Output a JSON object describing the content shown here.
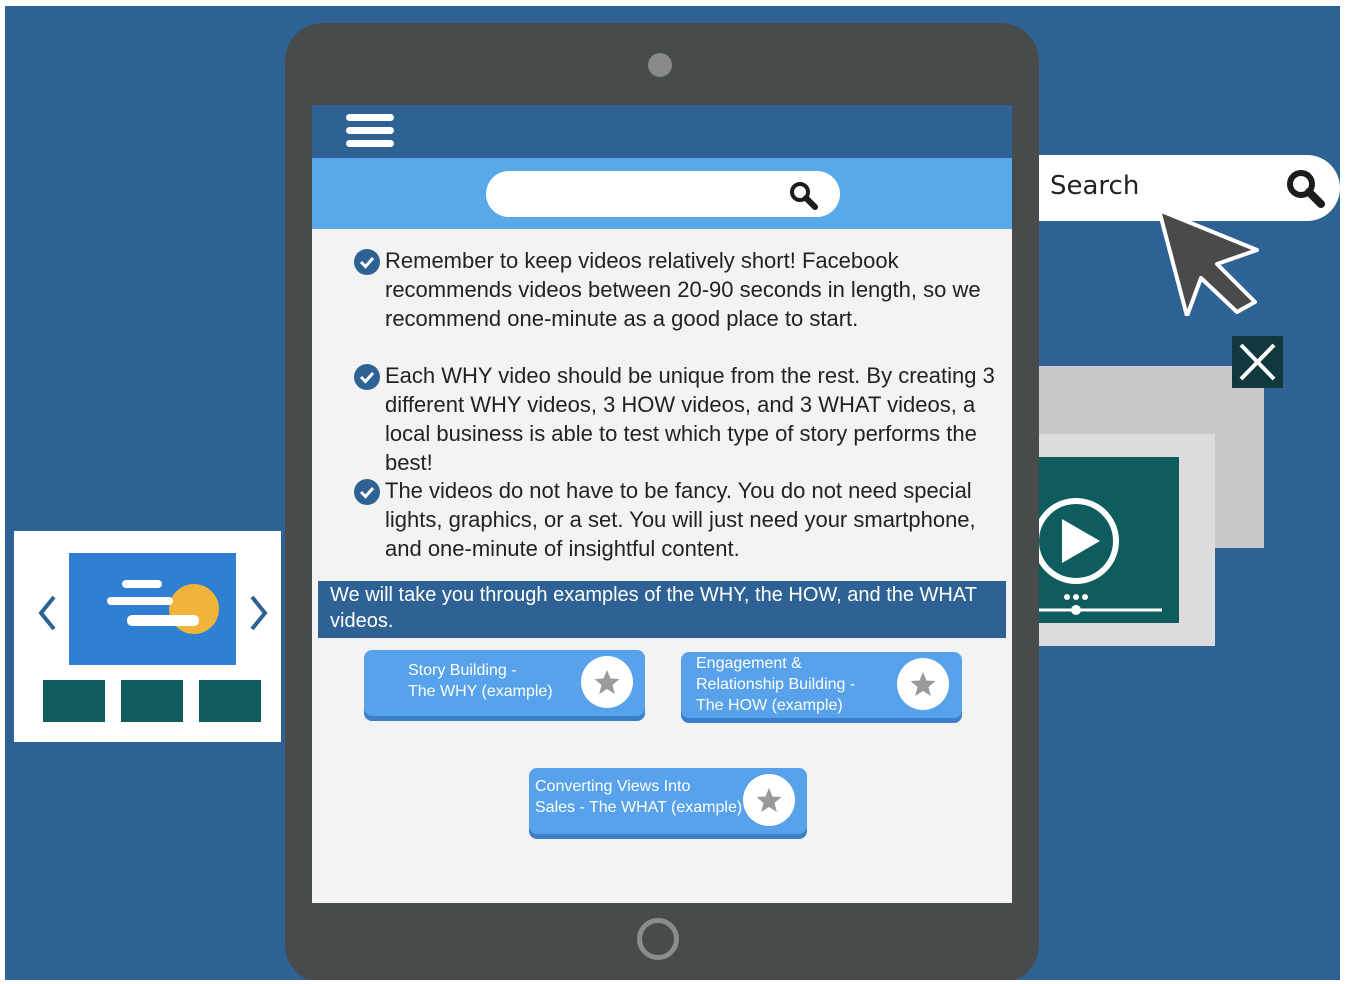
{
  "search_widget": {
    "placeholder": "Search",
    "search_icon": "magnifier-icon"
  },
  "tablet": {
    "menu_icon": "hamburger-icon",
    "tips": [
      "Remember to keep videos relatively short! Facebook recommends videos between 20-90 seconds in length, so we recommend one-minute as a good place to start.",
      "Each WHY video should be unique from the rest. By creating 3 different WHY videos, 3 HOW videos, and 3 WHAT videos, a local business is able to test which type of story performs the best!",
      "The videos do not have to be fancy. You do not need special lights, graphics, or a set. You will just need your smartphone, and one-minute of insightful content."
    ],
    "banner": "We will take you through examples of the WHY, the HOW, and the WHAT videos.",
    "buttons": [
      {
        "line1": "Story Building -",
        "line2": "The WHY (example)"
      },
      {
        "line1": "Engagement &",
        "line2": "Relationship Building -",
        "line3": "The HOW (example)"
      },
      {
        "line1": "Converting Views Into",
        "line2": "Sales - The WHAT (example)"
      }
    ]
  },
  "colors": {
    "background": "#2f6294",
    "accent_blue": "#57a9ea",
    "teal": "#0f5c5f",
    "sun": "#f0b43a"
  }
}
